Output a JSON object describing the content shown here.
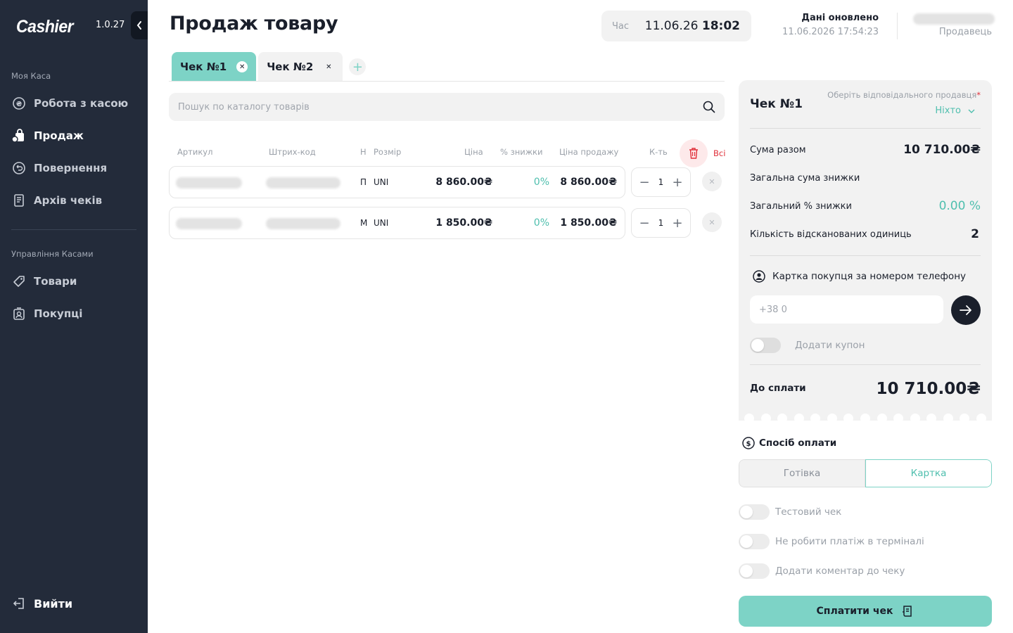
{
  "app": {
    "logo": "Cashier",
    "version": "1.0.27"
  },
  "sidebar": {
    "section1_title": "Моя Каса",
    "section2_title": "Управління Касами",
    "items": [
      {
        "label": "Робота з касою",
        "icon": "coin-icon"
      },
      {
        "label": "Продаж",
        "icon": "shopping-bag-icon",
        "active": true
      },
      {
        "label": "Повернення",
        "icon": "return-icon"
      },
      {
        "label": "Архів чеків",
        "icon": "receipt-archive-icon"
      },
      {
        "label": "Товари",
        "icon": "tag-icon"
      },
      {
        "label": "Покупці",
        "icon": "customer-icon"
      }
    ],
    "logout_label": "Вийти"
  },
  "header": {
    "title": "Продаж товару",
    "time_label": "Час",
    "date": "11.06.26",
    "time": "18:02",
    "updated_title": "Дані оновлено",
    "updated_date": "11.06.2026 17:54:23",
    "seller_label": "Продавець"
  },
  "tabs": [
    {
      "label": "Чек №1",
      "active": true
    },
    {
      "label": "Чек №2",
      "active": false
    }
  ],
  "search": {
    "placeholder": "Пошук по каталогу товарів"
  },
  "table": {
    "columns": {
      "article": "Артикул",
      "barcode": "Штрих-код",
      "name": "Н",
      "size": "Розмір",
      "price": "Ціна",
      "discount": "% знижки",
      "sale_price": "Ціна продажу",
      "qty": "К-ть"
    },
    "clear_all_label": "Всі",
    "rows": [
      {
        "name": "П",
        "size": "UNI",
        "price": "8 860.00₴",
        "discount": "0%",
        "sale_price": "8 860.00₴",
        "qty": "1"
      },
      {
        "name": "М",
        "size": "UNI",
        "price": "1 850.00₴",
        "discount": "0%",
        "sale_price": "1 850.00₴",
        "qty": "1"
      }
    ]
  },
  "receipt": {
    "title": "Чек №1",
    "seller_select_label": "Оберіть відповідального продавця",
    "seller_select_required": "*",
    "seller_value": "Ніхто",
    "total_label": "Сума разом",
    "total_value": "10 710.00₴",
    "discount_sum_label": "Загальна сума знижки",
    "discount_pct_label": "Загальний % знижки",
    "discount_pct_value": "0.00 %",
    "units_label": "Кількість відсканованих одиниць",
    "units_value": "2",
    "customer_card_label": "Картка покупця за номером телефону",
    "phone_placeholder": "+38 0",
    "coupon_label": "Додати купон",
    "to_pay_label": "До сплати",
    "to_pay_value": "10 710.00₴"
  },
  "payment": {
    "title": "Спосіб оплати",
    "methods": [
      "Готівка",
      "Картка"
    ],
    "selected": "Картка",
    "options": [
      "Тестовий чек",
      "Не робити платіж в терміналі",
      "Додати коментар до чеку"
    ],
    "pay_button": "Сплатити чек"
  },
  "colors": {
    "sidebar": "#232b3a",
    "accent": "#7dd3c6",
    "accent_text": "#4fbfae",
    "danger": "#e0303a"
  }
}
